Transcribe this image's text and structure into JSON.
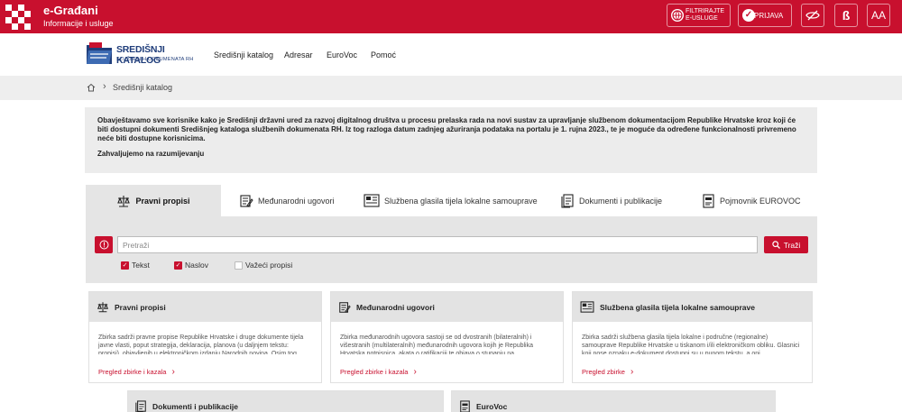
{
  "topbar": {
    "brand_title": "e-Građani",
    "brand_subtitle": "Informacije i usluge",
    "filter_label_1": "FILTRIRAJTE",
    "filter_label_2": "E-USLUGE",
    "login_label": "PRIJAVA",
    "font_size_label": "AA",
    "font_toggle_label": "ß"
  },
  "nav": {
    "logo_title": "SREDIŠNJI KATALOG",
    "logo_subtitle": "SLUŽBENIH DOKUMENATA RH",
    "links": [
      "Središnji katalog",
      "Adresar",
      "EuroVoc",
      "Pomoć"
    ]
  },
  "breadcrumb": {
    "current": "Središnji katalog"
  },
  "notice": {
    "paragraph": "Obavještavamo sve korisnike kako je Središnji državni ured za razvoj digitalnog društva u procesu prelaska rada na novi sustav za upravljanje službenom dokumentacijom Republike Hrvatske kroz koji će biti dostupni dokumenti Središnjeg kataloga službenih dokumenata RH. Iz tog razloga datum zadnjeg ažuriranja podataka na portalu je 1. rujna 2023., te je moguće da određene funkcionalnosti privremeno neće biti dostupne korisnicima.",
    "thanks": "Zahvaljujemo na razumijevanju"
  },
  "tabs": [
    "Pravni propisi",
    "Međunarodni ugovori",
    "Službena glasila tijela lokalne samouprave",
    "Dokumenti i publikacije",
    "Pojmovnik EUROVOC"
  ],
  "search": {
    "placeholder": "Pretraži",
    "button_label": "Traži",
    "checkboxes": [
      {
        "label": "Tekst",
        "checked": true
      },
      {
        "label": "Naslov",
        "checked": true
      },
      {
        "label": "Važeći propisi",
        "checked": false
      }
    ]
  },
  "cards": [
    {
      "title": "Pravni propisi",
      "text": "Zbirka sadrži pravne propise Republike Hrvatske i druge dokumente tijela javne vlasti, poput strategija, deklaracija, planova (u daljnjem tekstu: propisi), objavljenih u elektroničkom izdanju Narodnih novina. Osim tog...",
      "link": "Pregled zbirke i kazala"
    },
    {
      "title": "Međunarodni ugovori",
      "text": "Zbirka međunarodnih ugovora sastoji se od dvostranih (bilateralnih) i višestranih (multilateralnih) međunarodnih ugovora kojih je Republika Hrvatska potpisnica, akata o ratifikaciji te objava o stupanju na...",
      "link": "Pregled zbirke i kazala"
    },
    {
      "title": "Službena glasila tijela lokalne samouprave",
      "text": "Zbirka sadrži službena glasila tijela lokalne i područne (regionalne) samouprave Republike Hrvatske u tiskanom i/ili elektroničkom obliku. Glasnici koji nose oznaku e-dokument dostupni su u punom tekstu, a oni ...",
      "link": "Pregled zbirke"
    },
    {
      "title": "Dokumenti i publikacije"
    },
    {
      "title": "EuroVoc"
    }
  ],
  "colors": {
    "brand_red": "#c8102e",
    "catalog_blue": "#1f3d7a"
  }
}
